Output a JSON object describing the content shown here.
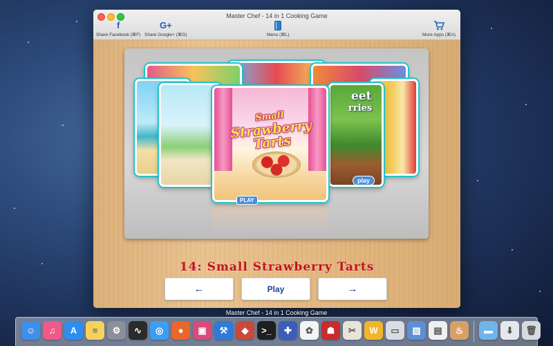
{
  "window": {
    "title": "Master Chef - 14 in 1 Cooking Game"
  },
  "toolbar": {
    "share_facebook": "Share Facebook (⌘F)",
    "share_google": "Share Google+ (⌘G)",
    "menu": "Menu (⌘L)",
    "more_apps": "More Apps (⌘A)",
    "facebook_glyph": "f",
    "google_glyph": "G+"
  },
  "carousel": {
    "selected_title_line1": "Small",
    "selected_title_line2": "Strawberry",
    "selected_title_line3": "Tarts",
    "play_badge": "PLAY",
    "right_card_play_badge": "play",
    "right_card_text_1": "eet",
    "right_card_text_2": "rries"
  },
  "game_label": "14: Small Strawberry Tarts",
  "nav": {
    "prev": "←",
    "play": "Play",
    "next": "→"
  },
  "dock": {
    "hover_label": "Master Chef - 14 in 1 Cooking Game",
    "apps": [
      {
        "name": "finder-icon",
        "color": "#3d8fe8",
        "glyph": "☺"
      },
      {
        "name": "itunes-icon",
        "color": "#f05a86",
        "glyph": "♫"
      },
      {
        "name": "app-store-icon",
        "color": "#2e8ef0",
        "glyph": "A"
      },
      {
        "name": "notes-icon",
        "color": "#f6d25a",
        "glyph": "≡"
      },
      {
        "name": "system-preferences-icon",
        "color": "#8a8f98",
        "glyph": "⚙"
      },
      {
        "name": "activity-monitor-icon",
        "color": "#2b2b2b",
        "glyph": "∿"
      },
      {
        "name": "safari-icon",
        "color": "#3a9ef2",
        "glyph": "◎"
      },
      {
        "name": "firefox-icon",
        "color": "#e8672a",
        "glyph": "●"
      },
      {
        "name": "photo-app-icon",
        "color": "#d94b7a",
        "glyph": "▣"
      },
      {
        "name": "xcode-icon",
        "color": "#2f7ad6",
        "glyph": "⚒"
      },
      {
        "name": "app-icon-red-blue",
        "color": "#c84a3a",
        "glyph": "◆"
      },
      {
        "name": "terminal-icon",
        "color": "#1f1f1f",
        "glyph": ">_"
      },
      {
        "name": "game-controller-icon",
        "color": "#3a5fb8",
        "glyph": "✚"
      },
      {
        "name": "photos-icon",
        "color": "#f4f4f4",
        "glyph": "✿"
      },
      {
        "name": "ladybug-app-icon",
        "color": "#c82c2c",
        "glyph": "☗"
      },
      {
        "name": "scissors-icon",
        "color": "#e9e4d8",
        "glyph": "✂"
      },
      {
        "name": "wunderlist-icon",
        "color": "#f1b52a",
        "glyph": "W"
      },
      {
        "name": "ruler-icon",
        "color": "#d8dde4",
        "glyph": "▭"
      },
      {
        "name": "preview-icon",
        "color": "#5b8fd6",
        "glyph": "▧"
      },
      {
        "name": "document-icon",
        "color": "#f0f0f0",
        "glyph": "▤"
      },
      {
        "name": "master-chef-icon",
        "color": "#d9a066",
        "glyph": "♨"
      }
    ],
    "folder_icons": [
      {
        "name": "folder-icon",
        "color": "#6fb4ea",
        "glyph": "▬"
      },
      {
        "name": "downloads-icon",
        "color": "#e4e8ee",
        "glyph": "⬇"
      },
      {
        "name": "trash-icon",
        "color": "#d7dbe0",
        "glyph": "🗑"
      }
    ]
  }
}
